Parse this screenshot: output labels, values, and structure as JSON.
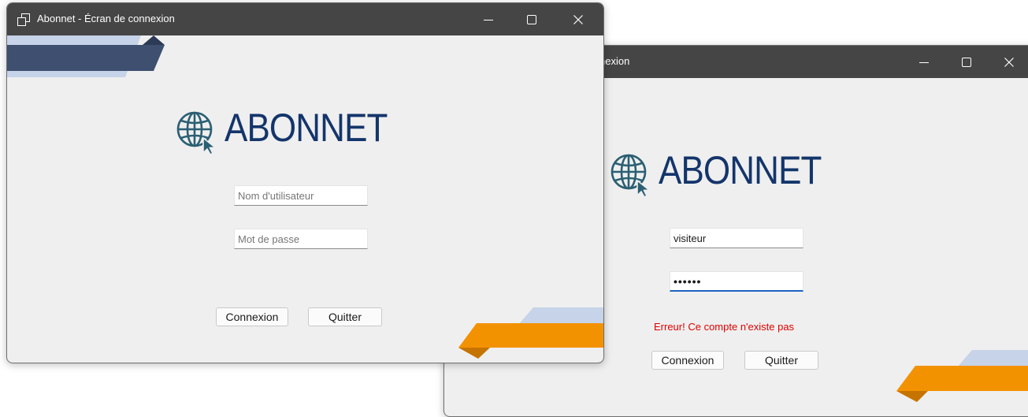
{
  "colors": {
    "titlebar": "#454545",
    "window_bg": "#efefef",
    "logo_text": "#14356b",
    "globe": "#2b5f73",
    "ribbon_navy": "#3e4f70",
    "ribbon_light": "#c6d3e8",
    "ribbon_orange": "#f39200",
    "error": "#e00000",
    "focus": "#1b64c4"
  },
  "windows": {
    "front": {
      "title": "Abonnet - Écran de connexion",
      "logo_text": "ABONNET",
      "username_placeholder": "Nom d'utilisateur",
      "password_placeholder": "Mot de passe",
      "login_label": "Connexion",
      "quit_label": "Quitter"
    },
    "back": {
      "title_visible": "nexion",
      "logo_text": "ABONNET",
      "username_value": "visiteur",
      "password_value": "••••••",
      "error_message": "Erreur! Ce compte n'existe pas",
      "login_label": "Connexion",
      "quit_label": "Quitter"
    }
  }
}
